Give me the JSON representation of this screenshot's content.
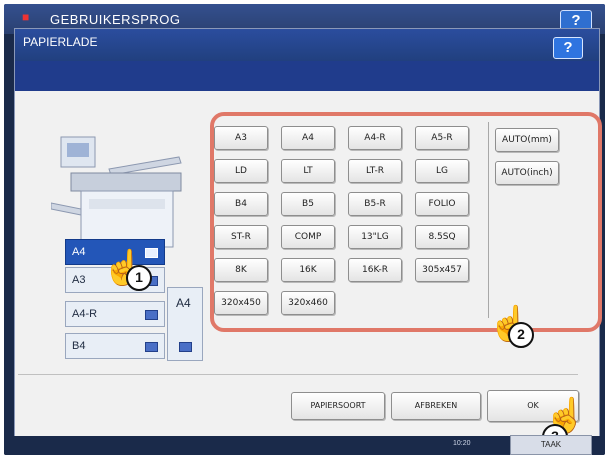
{
  "outer": {
    "title": "GEBRUIKERSPROG",
    "help": "?"
  },
  "dialog": {
    "title": "PAPIERLADE",
    "help": "?"
  },
  "trays": [
    {
      "label": "A4",
      "selected": true
    },
    {
      "label": "A3",
      "selected": false
    },
    {
      "label": "A4-R",
      "selected": false
    },
    {
      "label": "B4",
      "selected": false
    }
  ],
  "bypass_tray": {
    "label": "A4"
  },
  "sizes": [
    [
      "A3",
      "A4",
      "A4-R",
      "A5-R"
    ],
    [
      "LD",
      "LT",
      "LT-R",
      "LG"
    ],
    [
      "B4",
      "B5",
      "B5-R",
      "FOLIO"
    ],
    [
      "ST-R",
      "COMP",
      "13\"LG",
      "8.5SQ"
    ],
    [
      "8K",
      "16K",
      "16K-R",
      "305x457"
    ],
    [
      "320x450",
      "320x460"
    ]
  ],
  "auto_buttons": [
    "AUTO(mm)",
    "AUTO(inch)"
  ],
  "footer_buttons": {
    "papiersoort": "PAPIERSOORT",
    "afbreken": "AFBREKEN",
    "ok": "OK"
  },
  "status": {
    "time": "10:20",
    "taak": "TAAK"
  },
  "callouts": [
    "1",
    "2",
    "3"
  ],
  "colors": {
    "selected_tray": "#2356b8",
    "highlight": "#e07868",
    "header": "#2b4d9e"
  }
}
